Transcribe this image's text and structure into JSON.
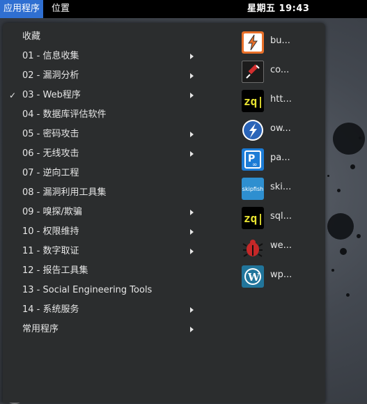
{
  "topbar": {
    "applications": "应用程序",
    "places": "位置",
    "clock": "星期五 19:43"
  },
  "menu": {
    "categories": [
      {
        "label": "收藏",
        "submenu": false,
        "checked": false
      },
      {
        "label": "01 - 信息收集",
        "submenu": true,
        "checked": false
      },
      {
        "label": "02 - 漏洞分析",
        "submenu": true,
        "checked": false
      },
      {
        "label": "03 - Web程序",
        "submenu": true,
        "checked": true
      },
      {
        "label": "04 - 数据库评估软件",
        "submenu": false,
        "checked": false
      },
      {
        "label": "05 - 密码攻击",
        "submenu": true,
        "checked": false
      },
      {
        "label": "06 - 无线攻击",
        "submenu": true,
        "checked": false
      },
      {
        "label": "07 - 逆向工程",
        "submenu": false,
        "checked": false
      },
      {
        "label": "08 - 漏洞利用工具集",
        "submenu": false,
        "checked": false
      },
      {
        "label": "09 - 嗅探/欺骗",
        "submenu": true,
        "checked": false
      },
      {
        "label": "10 - 权限维持",
        "submenu": true,
        "checked": false
      },
      {
        "label": "11 - 数字取证",
        "submenu": true,
        "checked": false
      },
      {
        "label": "12 - 报告工具集",
        "submenu": false,
        "checked": false
      },
      {
        "label": "13 - Social Engineering Tools",
        "submenu": false,
        "checked": false
      },
      {
        "label": "14 - 系统服务",
        "submenu": true,
        "checked": false
      },
      {
        "label": "常用程序",
        "submenu": true,
        "checked": false
      }
    ],
    "check_glyph": "✓",
    "apps": [
      {
        "label": "bu...",
        "icon": "burpsuite-icon"
      },
      {
        "label": "co...",
        "icon": "commix-icon"
      },
      {
        "label": "htt...",
        "icon": "httrack-icon"
      },
      {
        "label": "ow...",
        "icon": "owasp-zap-icon"
      },
      {
        "label": "pa...",
        "icon": "paros-icon"
      },
      {
        "label": "ski...",
        "icon": "skipfish-icon",
        "icon_text": "skipfish"
      },
      {
        "label": "sql...",
        "icon": "sqlmap-icon"
      },
      {
        "label": "we...",
        "icon": "webscarab-icon"
      },
      {
        "label": "wp...",
        "icon": "wpscan-icon"
      }
    ]
  },
  "colors": {
    "topbar_active": "#2f6fd1",
    "menu_bg": "#2b2d2e",
    "burp_orange": "#e8702a",
    "zap_blue": "#2a64b8",
    "paros_blue": "#1c7cd6",
    "skipfish_blue": "#2e8fd0",
    "webscarab_red": "#c62828",
    "wpscan_blue": "#21759b"
  }
}
